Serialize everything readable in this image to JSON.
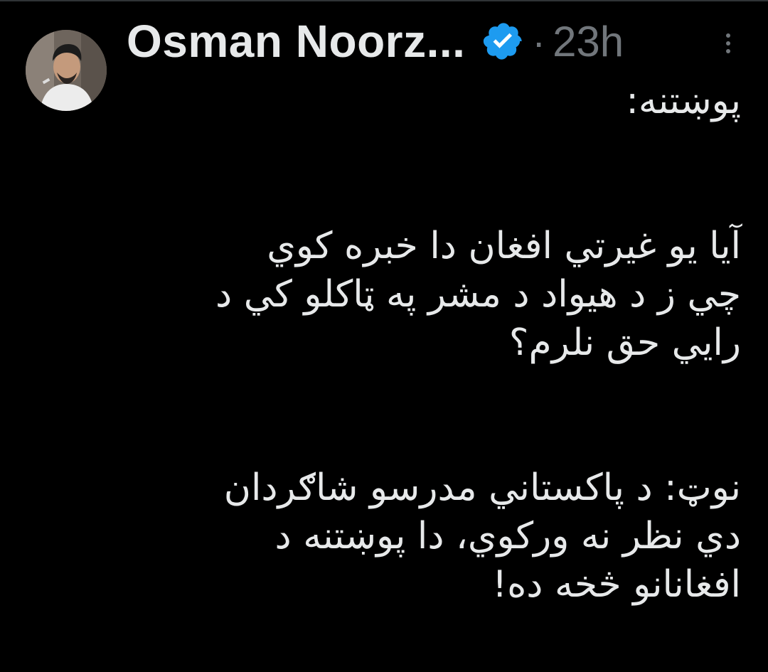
{
  "tweet": {
    "author_name": "Osman Noorz...",
    "verified": true,
    "separator": "·",
    "time": "23h",
    "more_icon": "more-vertical-icon",
    "text_lines": [
      "پوښتنه:",
      "",
      "آیا یو غیرتي افغان دا خبره کوي",
      "چي ز د هیواد د مشر په ټاکلو کي د",
      "رایي حق نلرم؟",
      "",
      "نوټ: د پاکستاني مدرسو شاګردان",
      "دي نظر نه ورکوي، دا پوښتنه د",
      "افغانانو څخه ده!"
    ]
  },
  "colors": {
    "background": "#000000",
    "text": "#e7e9ea",
    "secondary": "#71767b",
    "verified_badge": "#1d9bf0"
  }
}
